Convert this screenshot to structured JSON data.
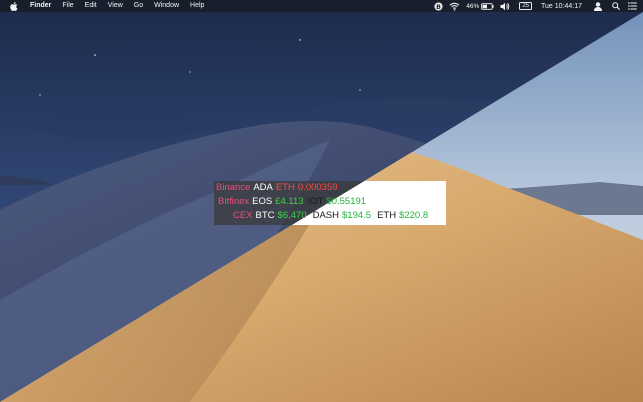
{
  "menubar": {
    "apple_icon": "apple-icon",
    "app_name": "Finder",
    "menus": [
      "File",
      "Edit",
      "View",
      "Go",
      "Window",
      "Help"
    ],
    "status": {
      "bitcoin_icon": "bitcoin-icon",
      "wifi_icon": "wifi-icon",
      "battery_percent": "46%",
      "battery_icon": "battery-icon",
      "volume_icon": "volume-icon",
      "calendar_badge": "25",
      "clock": "Tue 10:44:17",
      "user_icon": "user-icon",
      "search_icon": "search-icon",
      "notification_icon": "list-icon"
    }
  },
  "ticker": {
    "rows": [
      {
        "exchange": "Binance",
        "quotes": [
          {
            "symbol": "ADA",
            "quote_symbol": "ETH",
            "price": "0.000359",
            "direction": "down"
          }
        ]
      },
      {
        "exchange": "Bitfinex",
        "quotes": [
          {
            "symbol": "EOS",
            "price": "£4.113",
            "direction": "up"
          },
          {
            "symbol": "IOT",
            "price": "$0.55191",
            "direction": "up"
          }
        ]
      },
      {
        "exchange": "CEX",
        "quotes": [
          {
            "symbol": "BTC",
            "price": "$6,470",
            "direction": "up"
          },
          {
            "symbol": "DASH",
            "price": "$194.5",
            "direction": "up"
          },
          {
            "symbol": "ETH",
            "price": "$220.8",
            "direction": "up"
          }
        ]
      }
    ]
  },
  "colors": {
    "exchange": "#ee4d7a",
    "up": "#3fd24a",
    "down": "#ff4b3e"
  }
}
